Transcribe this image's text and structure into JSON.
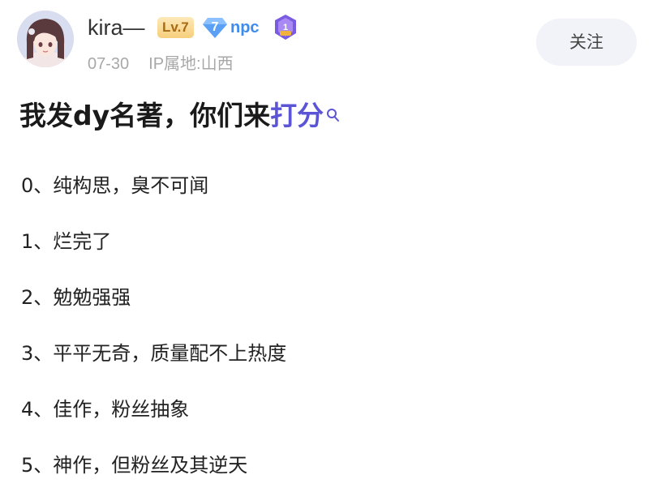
{
  "author": {
    "name": "kira—",
    "level": "Lv.7",
    "badge_number": "7",
    "badge_label": "npc",
    "medal_number": "1",
    "date": "07-30",
    "ip_location": "IP属地:山西"
  },
  "follow_button": "关注",
  "post": {
    "title_main": "我发dy名著，你们来",
    "title_highlight": "打分",
    "items": [
      "0、纯构思，臭不可闻",
      "1、烂完了",
      "2、勉勉强强",
      "3、平平无奇，质量配不上热度",
      "4、佳作，粉丝抽象",
      "5、神作，但粉丝及其逆天"
    ]
  },
  "colors": {
    "accent": "#5b55d6",
    "npc_blue": "#3f8cef",
    "level_gold": "#f6cf7c",
    "meta_gray": "#a8a8a8"
  }
}
